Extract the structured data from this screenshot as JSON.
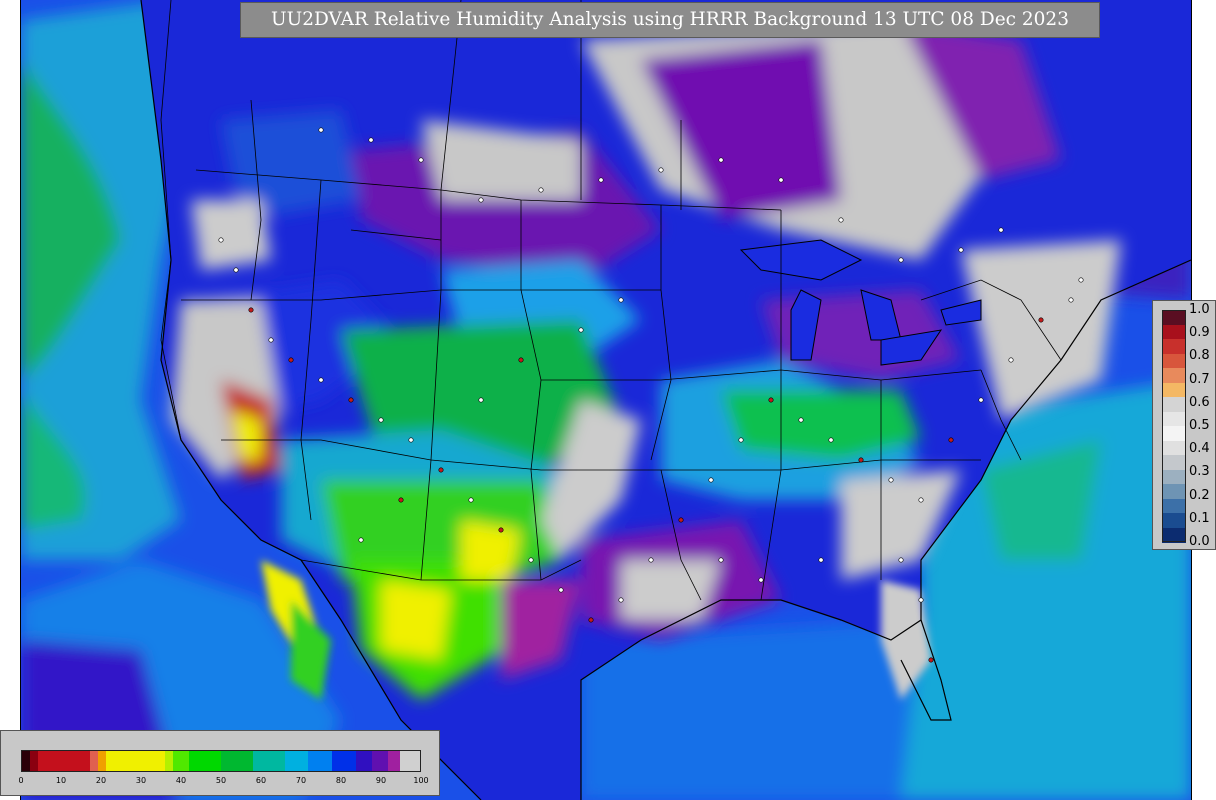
{
  "title": "UU2DVAR Relative Humidity Analysis using HRRR Background 13 UTC 08 Dec 2023",
  "legend_right": {
    "ticks": [
      "1.0",
      "0.9",
      "0.8",
      "0.7",
      "0.6",
      "0.5",
      "0.4",
      "0.3",
      "0.2",
      "0.1",
      "0.0"
    ],
    "colors_top_to_bottom": [
      "#5a0e22",
      "#a8101c",
      "#c8302c",
      "#d8563c",
      "#e88a5c",
      "#f4b864",
      "#d4d4d4",
      "#e6e6e6",
      "#f4f4f4",
      "#e0e0e0",
      "#c4c8cc",
      "#9cb0c0",
      "#6e94b4",
      "#3c70a8",
      "#1a4c90",
      "#0c2c70"
    ]
  },
  "legend_bottom": {
    "ticks": [
      "0",
      "10",
      "20",
      "30",
      "40",
      "50",
      "60",
      "70",
      "80",
      "90",
      "100"
    ],
    "segments": [
      {
        "from": 0,
        "to": 2,
        "color": "#2a0008"
      },
      {
        "from": 2,
        "to": 4,
        "color": "#8a0010"
      },
      {
        "from": 4,
        "to": 17,
        "color": "#c4101c"
      },
      {
        "from": 17,
        "to": 19,
        "color": "#e06050"
      },
      {
        "from": 19,
        "to": 21,
        "color": "#f0a000"
      },
      {
        "from": 21,
        "to": 36,
        "color": "#f0f000"
      },
      {
        "from": 36,
        "to": 38,
        "color": "#b4f000"
      },
      {
        "from": 38,
        "to": 42,
        "color": "#50e800"
      },
      {
        "from": 42,
        "to": 50,
        "color": "#00d800"
      },
      {
        "from": 50,
        "to": 58,
        "color": "#00b830"
      },
      {
        "from": 58,
        "to": 66,
        "color": "#00b8a0"
      },
      {
        "from": 66,
        "to": 72,
        "color": "#00b0e0"
      },
      {
        "from": 72,
        "to": 78,
        "color": "#0080f0"
      },
      {
        "from": 78,
        "to": 84,
        "color": "#0030e8"
      },
      {
        "from": 84,
        "to": 88,
        "color": "#3010c0"
      },
      {
        "from": 88,
        "to": 92,
        "color": "#6010b0"
      },
      {
        "from": 92,
        "to": 95,
        "color": "#a020a0"
      },
      {
        "from": 95,
        "to": 100,
        "color": "#d0d0d0"
      }
    ]
  },
  "colors": {
    "ocean_low": "#0090e0",
    "ocean_high": "#0040e0",
    "saturated": "#cfcfcf",
    "very_humid": "#6a18b0",
    "humid": "#1a30e0",
    "moist": "#1a98e8",
    "medium": "#10c040",
    "dry_mid": "#40e000",
    "dry": "#f0f000",
    "title_bg": "#8c8c8c"
  }
}
